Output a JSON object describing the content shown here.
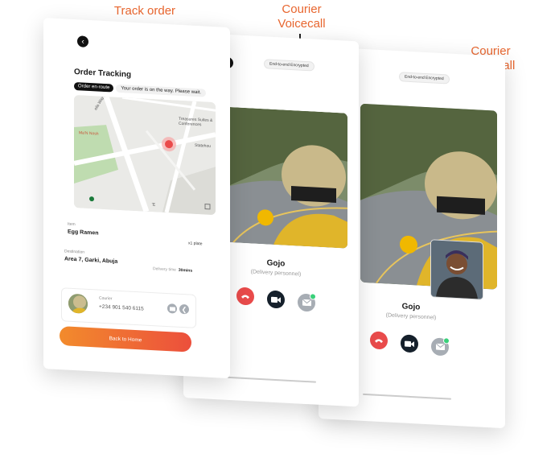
{
  "labels": {
    "track_order": "Track order",
    "voicecall_l1": "Courier",
    "voicecall_l2": "Voicecall",
    "videocall_l1": "Courier",
    "videocall_l2": "Videocall"
  },
  "tracking": {
    "title": "Order Tracking",
    "status_badge": "Order en-route",
    "status_text": "Your order is on the way. Please wait.",
    "map_labels": {
      "street": "eila Way",
      "restaurant": "Ma'N Nosh",
      "hotel": "Treasures Suites & Conferences",
      "statehouse": "Statehou",
      "corner": "Ar"
    },
    "item_label": "Item",
    "item_value": "Egg Ramen",
    "quantity": "x1 plate",
    "destination_label": "Destination",
    "destination_value": "Area 7, Garki, Abuja",
    "delivery_time_label": "Delivery time",
    "delivery_time_value": "30mins",
    "courier_label": "Courier",
    "courier_phone": "+234 901 540 6115",
    "back_button": "Back to Home"
  },
  "voicecall": {
    "encryption": "End-to-end Encrypted",
    "name": "Gojo",
    "role": "(Delivery personnel)"
  },
  "videocall": {
    "encryption": "End-to-end Encrypted",
    "name": "Gojo",
    "role": "(Delivery personnel)"
  },
  "colors": {
    "accent": "#e8662f",
    "end_call": "#e94b4b",
    "video_btn": "#15202b",
    "message_btn": "#a7adb4",
    "online": "#3ad07a"
  }
}
